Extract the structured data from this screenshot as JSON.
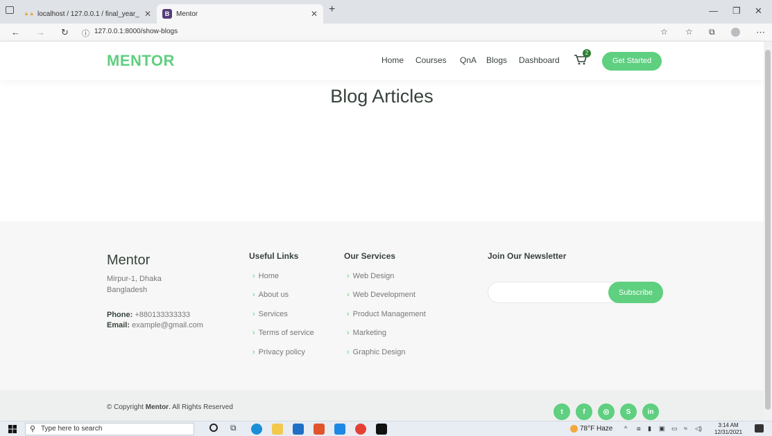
{
  "browser": {
    "tabs": [
      {
        "label": "localhost / 127.0.0.1 / final_year_"
      },
      {
        "label": "Mentor",
        "favicon": "B"
      }
    ],
    "url": "127.0.0.1:8000/show-blogs"
  },
  "header": {
    "logo": "MENTOR",
    "nav": [
      "Home",
      "Courses",
      "QnA",
      "Blogs",
      "Dashboard"
    ],
    "cart_count": "2",
    "cta": "Get Started"
  },
  "main": {
    "heading": "Blog Articles"
  },
  "footer": {
    "brand": "Mentor",
    "address_line1": "Mirpur-1, Dhaka",
    "address_line2": "Bangladesh",
    "phone_label": "Phone:",
    "phone": "+880133333333",
    "email_label": "Email:",
    "email": "example@gmail.com",
    "useful_links_title": "Useful Links",
    "useful_links": [
      "Home",
      "About us",
      "Services",
      "Terms of service",
      "Privacy policy"
    ],
    "services_title": "Our Services",
    "services": [
      "Web Design",
      "Web Development",
      "Product Management",
      "Marketing",
      "Graphic Design"
    ],
    "newsletter_title": "Join Our Newsletter",
    "subscribe": "Subscribe",
    "copyright_prefix": "© Copyright ",
    "copyright_brand": "Mentor",
    "copyright_suffix": ". All Rights Reserved"
  },
  "taskbar": {
    "search_placeholder": "Type here to search",
    "weather": "78°F Haze",
    "time": "3:14 AM",
    "date": "12/31/2021"
  },
  "colors": {
    "accent": "#5fcf80",
    "text": "#37423b"
  }
}
